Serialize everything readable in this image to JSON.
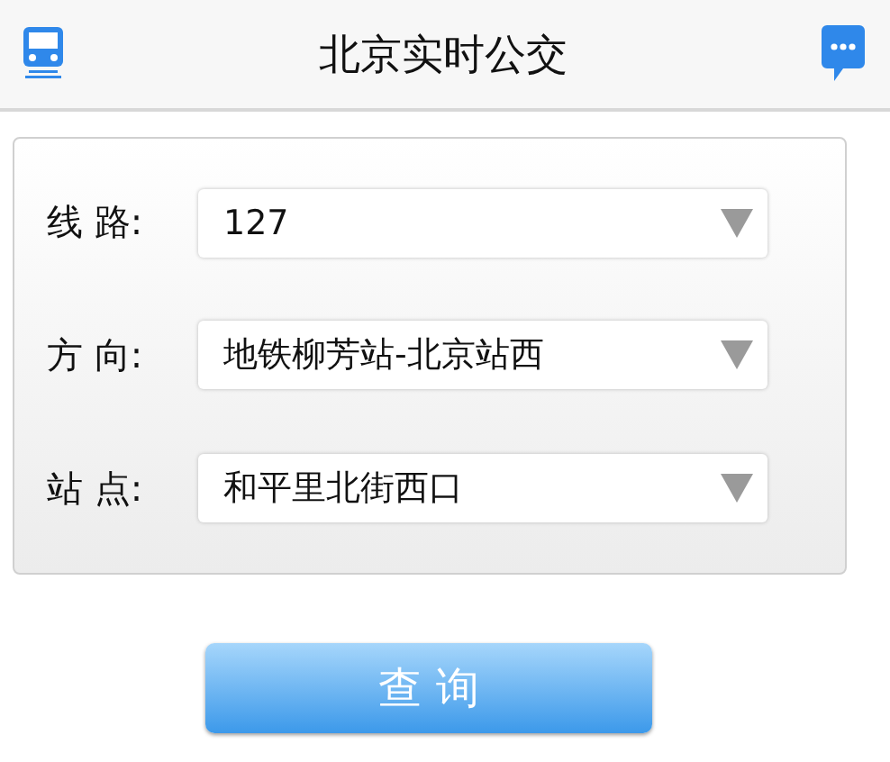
{
  "header": {
    "title": "北京实时公交"
  },
  "form": {
    "fields": [
      {
        "label": "线 路:",
        "value": "127"
      },
      {
        "label": "方 向:",
        "value": "地铁柳芳站-北京站西"
      },
      {
        "label": "站 点:",
        "value": "和平里北街西口"
      }
    ]
  },
  "button": {
    "label": "查 询"
  }
}
